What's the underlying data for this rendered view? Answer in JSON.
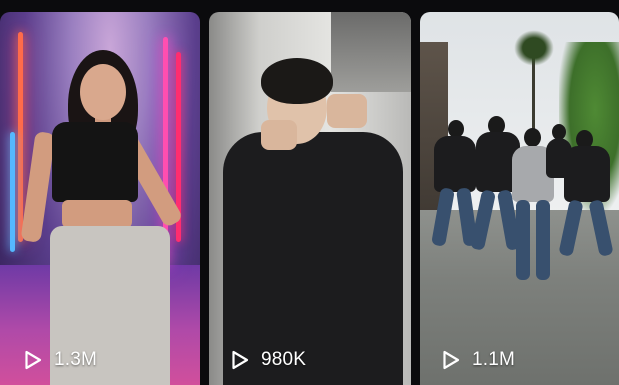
{
  "videos": [
    {
      "views": "1.3M",
      "icon": "play-icon"
    },
    {
      "views": "980K",
      "icon": "play-icon"
    },
    {
      "views": "1.1M",
      "icon": "play-icon"
    }
  ],
  "colors": {
    "background": "#0b0b0d",
    "overlay_text": "#ffffff"
  }
}
